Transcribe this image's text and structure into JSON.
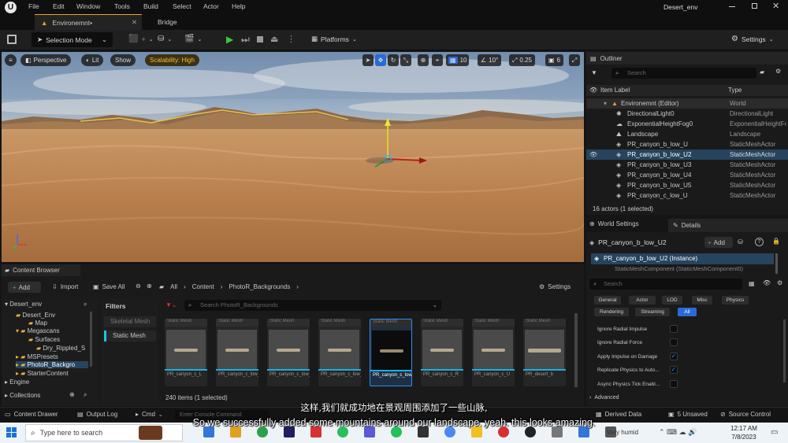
{
  "app": {
    "menu": [
      "File",
      "Edit",
      "Window",
      "Tools",
      "Build",
      "Select",
      "Actor",
      "Help"
    ],
    "project_name": "Desert_env",
    "tabs": [
      {
        "label": "Environemnt•"
      },
      {
        "label": "Bridge"
      }
    ]
  },
  "toolbar": {
    "selection_mode": "Selection Mode",
    "platforms": "Platforms",
    "settings": "Settings"
  },
  "viewport": {
    "perspective": "Perspective",
    "lit": "Lit",
    "show": "Show",
    "scalability": "Scalability: High",
    "grid_snap": "10",
    "rotation_snap": "10°",
    "scale_snap": "0.25",
    "camera_speed": "6"
  },
  "outliner": {
    "title": "Outliner",
    "search_placeholder": "Search",
    "col_label": "Item Label",
    "col_type": "Type",
    "rows": [
      {
        "label": "Environemnt (Editor)",
        "type": "World"
      },
      {
        "label": "DirectionalLight0",
        "type": "DirectionalLight"
      },
      {
        "label": "ExponentialHeightFog0",
        "type": "ExponentialHeightFog"
      },
      {
        "label": "Landscape",
        "type": "Landscape"
      },
      {
        "label": "PR_canyon_b_low_U",
        "type": "StaticMeshActor"
      },
      {
        "label": "PR_canyon_b_low_U2",
        "type": "StaticMeshActor"
      },
      {
        "label": "PR_canyon_b_low_U3",
        "type": "StaticMeshActor"
      },
      {
        "label": "PR_canyon_b_low_U4",
        "type": "StaticMeshActor"
      },
      {
        "label": "PR_canyon_b_low_U5",
        "type": "StaticMeshActor"
      },
      {
        "label": "PR_canyon_c_low_U",
        "type": "StaticMeshActor"
      }
    ],
    "footer": "16 actors (1 selected)"
  },
  "details": {
    "world_settings_tab": "World Settings",
    "details_tab": "Details",
    "actor_name": "PR_canyon_b_low_U2",
    "add_label": "Add",
    "instance_row": "PR_canyon_b_low_U2 (Instance)",
    "component_row": "StaticMeshComponent (StaticMeshComponent0)",
    "search_placeholder": "Search",
    "filters": [
      "General",
      "Actor",
      "LOD",
      "Misc",
      "Physics",
      "Rendering",
      "Streaming",
      "All"
    ],
    "properties": [
      {
        "label": "Ignore Radial Impulse",
        "checked": false
      },
      {
        "label": "Ignore Radial Force",
        "checked": false
      },
      {
        "label": "Apply Impulse on Damage",
        "checked": true
      },
      {
        "label": "Replicate Physics to Auto...",
        "checked": true
      },
      {
        "label": "Async Physics Tick Enabl...",
        "checked": false
      }
    ],
    "advanced": "Advanced"
  },
  "content_browser": {
    "title": "Content Browser",
    "add": "Add",
    "import": "Import",
    "save_all": "Save All",
    "breadcrumb": [
      "All",
      "Content",
      "PhotoR_Backgrounds"
    ],
    "settings": "Settings",
    "filters_label": "Filters",
    "filter_items": [
      "Skeletal Mesh",
      "Static Mesh"
    ],
    "search_placeholder": "Search PhotoR_Backgrounds",
    "tree": [
      "Desert_env",
      "Desert_Env",
      "Map",
      "Megascans",
      "Surfaces",
      "Dry_Rippled_S",
      "MSPresets",
      "PhotoR_Backgro",
      "StarterContent",
      "Engine"
    ],
    "collections": "Collections",
    "assets": [
      {
        "type": "Static Mesh",
        "name": "PR_canyon_c_L"
      },
      {
        "type": "Static Mesh",
        "name": "PR_canyon_c_low_D"
      },
      {
        "type": "Static Mesh",
        "name": "PR_canyon_c_low_L"
      },
      {
        "type": "Static Mesh",
        "name": "PR_canyon_c_low_R"
      },
      {
        "type": "Static Mesh",
        "name": "PR_canyon_c_low_U"
      },
      {
        "type": "Static Mesh",
        "name": "PR_canyon_c_R"
      },
      {
        "type": "Static Mesh",
        "name": "PR_canyon_c_U"
      },
      {
        "type": "Static Mesh",
        "name": "PR_desert_b"
      }
    ],
    "item_count": "240 items (1 selected)"
  },
  "statusbar": {
    "content_drawer": "Content Drawer",
    "output_log": "Output Log",
    "cmd": "Cmd",
    "console_placeholder": "Enter Console Command",
    "derived_data": "Derived Data",
    "unsaved": "5 Unsaved",
    "source_control": "Source Control"
  },
  "taskbar": {
    "search_placeholder": "Type here to search",
    "weather": "Very humid",
    "time": "12:17 AM",
    "date": "7/8/2023"
  },
  "subtitles": {
    "zh": "这样,我们就成功地在景观周围添加了一些山脉,",
    "en": "So we successfully added some mountains around our landscape. yeah. this looks amazing."
  }
}
